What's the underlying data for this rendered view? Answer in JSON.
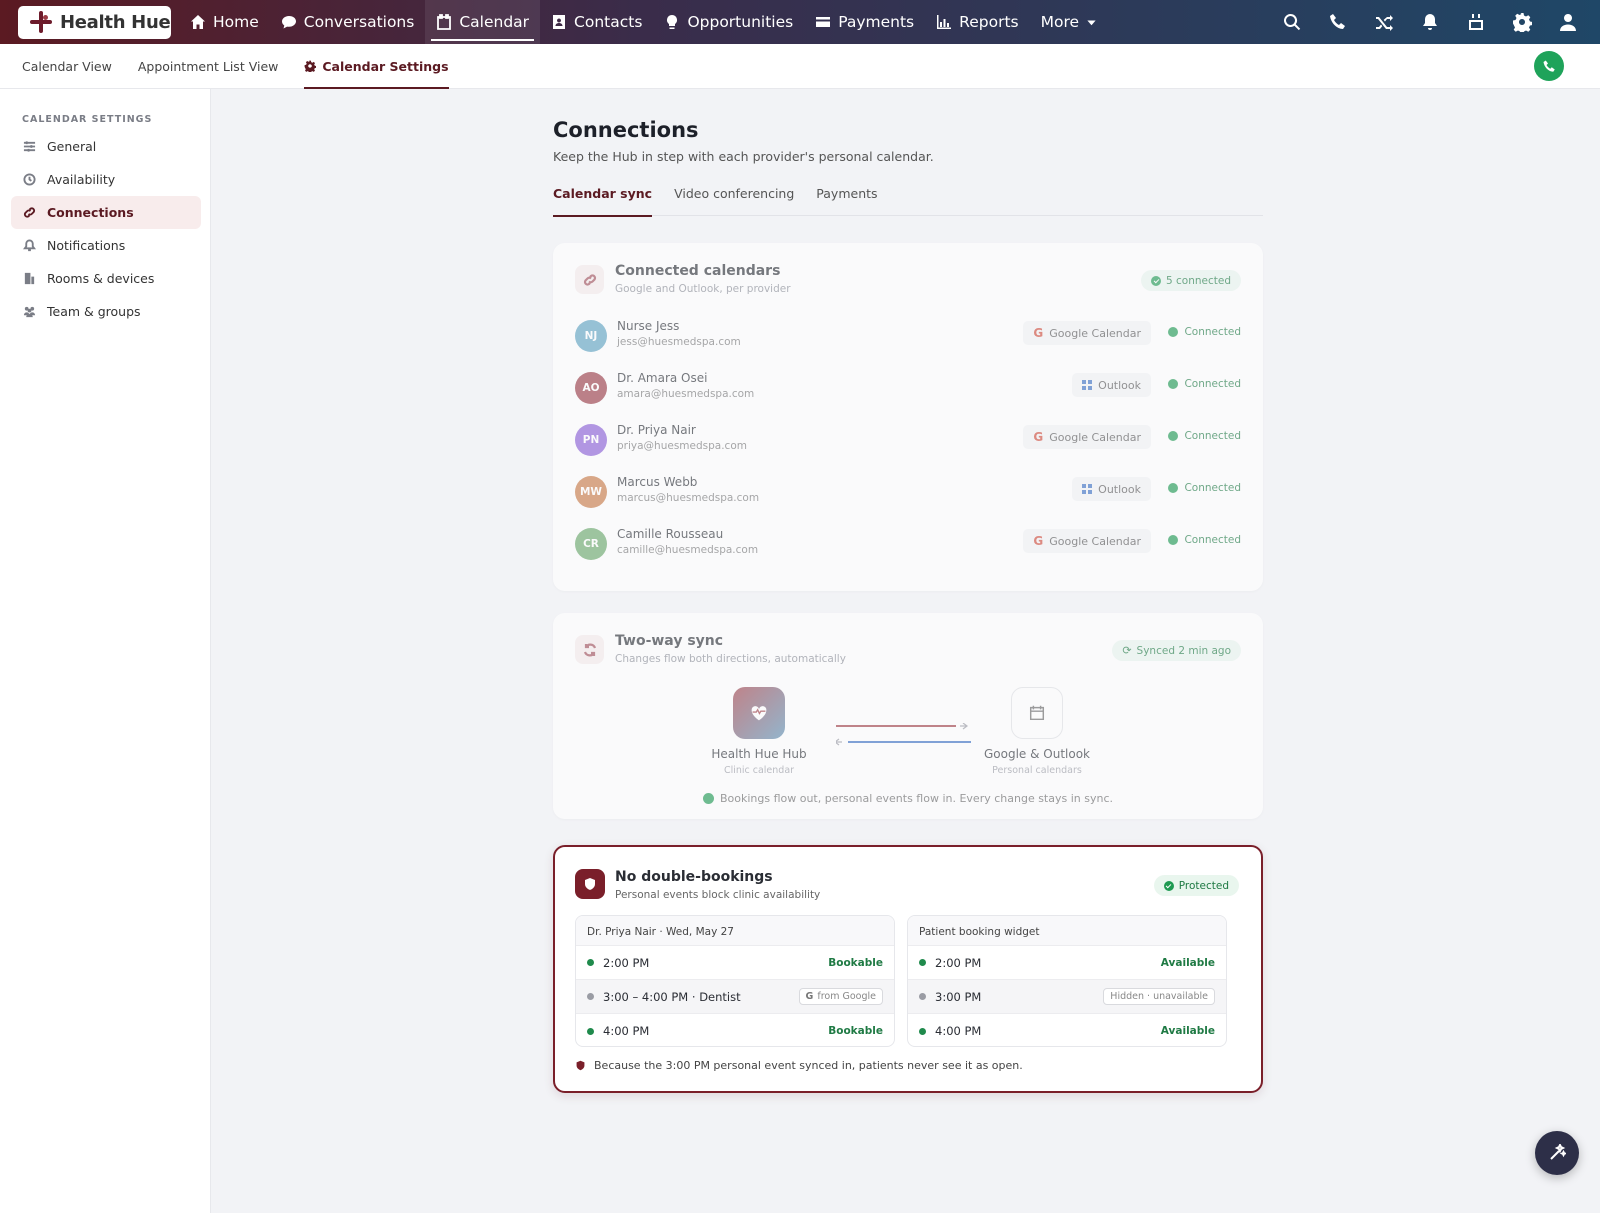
{
  "brand": {
    "name": "Health Hue"
  },
  "nav": [
    {
      "label": "Home",
      "icon": "home-icon"
    },
    {
      "label": "Conversations",
      "icon": "chat-icon"
    },
    {
      "label": "Calendar",
      "icon": "calendar-icon",
      "active": true
    },
    {
      "label": "Contacts",
      "icon": "contacts-icon"
    },
    {
      "label": "Opportunities",
      "icon": "lightbulb-icon"
    },
    {
      "label": "Payments",
      "icon": "credit-card-icon"
    },
    {
      "label": "Reports",
      "icon": "bar-chart-icon"
    },
    {
      "label": "More",
      "icon": "caret-down-icon"
    }
  ],
  "top_icons": [
    "search-icon",
    "phone-icon",
    "shuffle-icon",
    "bell-icon",
    "calendar-icon",
    "gear-icon",
    "user-icon"
  ],
  "subnav": {
    "tabs": [
      "Calendar View",
      "Appointment List View",
      "Calendar Settings"
    ],
    "active": "Calendar Settings"
  },
  "sidebar": {
    "heading": "CALENDAR SETTINGS",
    "items": [
      {
        "label": "General",
        "icon": "sliders-icon"
      },
      {
        "label": "Availability",
        "icon": "clock-icon"
      },
      {
        "label": "Connections",
        "icon": "link-icon",
        "active": true
      },
      {
        "label": "Notifications",
        "icon": "bell-icon"
      },
      {
        "label": "Rooms & devices",
        "icon": "building-icon"
      },
      {
        "label": "Team & groups",
        "icon": "users-icon"
      }
    ]
  },
  "page": {
    "title": "Connections",
    "subtitle": "Keep the Hub in step with each provider's personal calendar.",
    "tabs": [
      "Calendar sync",
      "Video conferencing",
      "Payments"
    ],
    "active_tab": "Calendar sync"
  },
  "connected": {
    "title": "Connected calendars",
    "subtitle": "Google and Outlook, per provider",
    "badge": "5 connected",
    "providers": [
      {
        "initials": "NJ",
        "name": "Nurse Jess",
        "email": "jess@huesmedspa.com",
        "calendar": "Google Calendar",
        "status": "Connected",
        "color": "#5fa3c2"
      },
      {
        "initials": "AO",
        "name": "Dr. Amara Osei",
        "email": "amara@huesmedspa.com",
        "calendar": "Outlook",
        "status": "Connected",
        "color": "#9a3b45"
      },
      {
        "initials": "PN",
        "name": "Dr. Priya Nair",
        "email": "priya@huesmedspa.com",
        "calendar": "Google Calendar",
        "status": "Connected",
        "color": "#8a5ed6"
      },
      {
        "initials": "MW",
        "name": "Marcus Webb",
        "email": "marcus@huesmedspa.com",
        "calendar": "Outlook",
        "status": "Connected",
        "color": "#c97a45"
      },
      {
        "initials": "CR",
        "name": "Camille Rousseau",
        "email": "camille@huesmedspa.com",
        "calendar": "Google Calendar",
        "status": "Connected",
        "color": "#6aa86a"
      }
    ]
  },
  "sync": {
    "title": "Two-way sync",
    "subtitle": "Changes flow both directions, automatically",
    "badge": "Synced 2 min ago",
    "left_label": "Health Hue Hub",
    "left_sub": "Clinic calendar",
    "right_label": "Google & Outlook",
    "right_sub": "Personal calendars",
    "note": "Bookings flow out, personal events flow in. Every change stays in sync."
  },
  "protect": {
    "title": "No double-bookings",
    "subtitle": "Personal events block clinic availability",
    "badge": "Protected",
    "left": {
      "header": "Dr. Priya Nair · Wed, May 27",
      "rows": [
        {
          "time": "2:00 PM",
          "tag": "Bookable"
        },
        {
          "time": "3:00 – 4:00 PM · Dentist",
          "chip": "from Google"
        },
        {
          "time": "4:00 PM",
          "tag": "Bookable"
        }
      ]
    },
    "right": {
      "header": "Patient booking widget",
      "rows": [
        {
          "time": "2:00 PM",
          "tag": "Available"
        },
        {
          "time": "3:00 PM",
          "chip": "Hidden · unavailable"
        },
        {
          "time": "4:00 PM",
          "tag": "Available"
        }
      ]
    },
    "note": "Because the 3:00 PM personal event synced in, patients never see it as open."
  },
  "colors": {
    "brand": "#5b1a22",
    "accent_green": "#1f9a52",
    "nav_start": "#5b1a22",
    "nav_end": "#1f4767"
  }
}
